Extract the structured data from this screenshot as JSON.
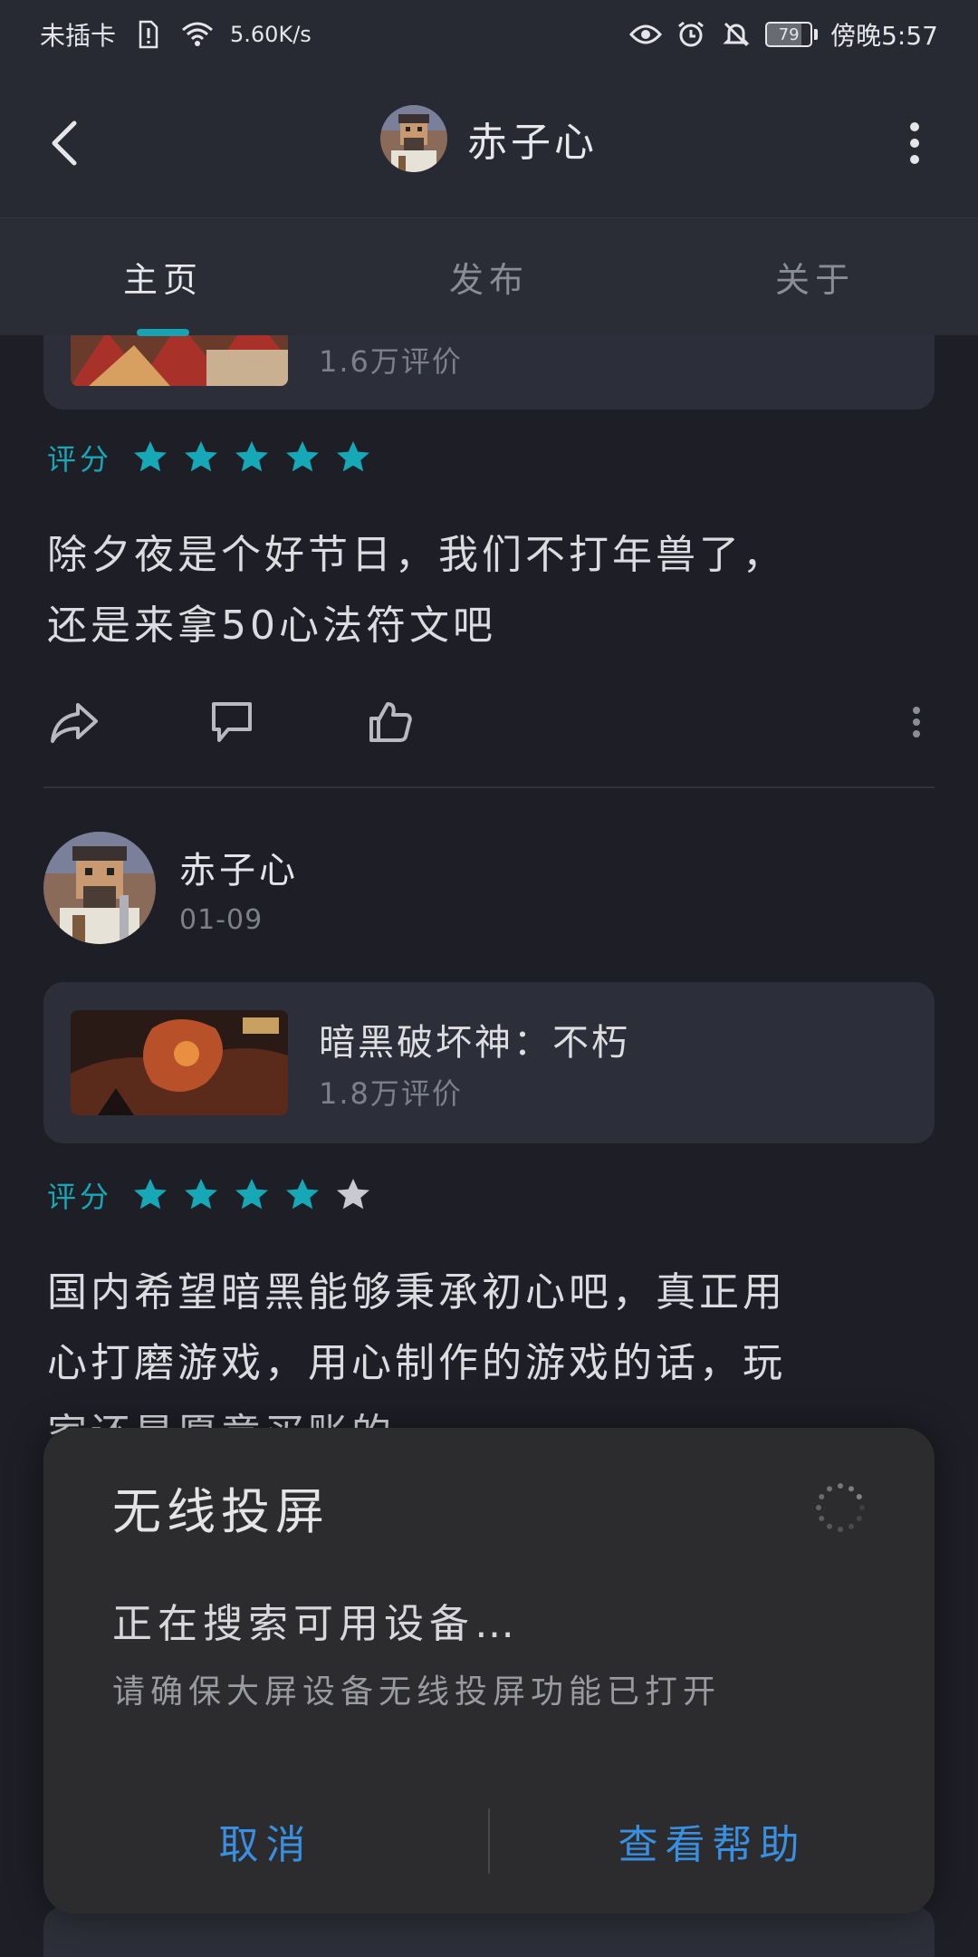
{
  "status_bar": {
    "carrier": "未插卡",
    "speed": "5.60K/s",
    "battery": "79",
    "time": "傍晚5:57"
  },
  "app_bar": {
    "title": "赤子心"
  },
  "tabs": [
    {
      "label": "主页",
      "active": true
    },
    {
      "label": "发布",
      "active": false
    },
    {
      "label": "关于",
      "active": false
    }
  ],
  "feed": {
    "partial_card": {
      "reviews": "1.6万评价"
    },
    "post1": {
      "rating_label": "评分",
      "rating": 5,
      "text_line1": "除夕夜是个好节日，我们不打年兽了，",
      "text_line2": "还是来拿50心法符文吧"
    },
    "post2": {
      "author": "赤子心",
      "date": "01-09",
      "game": {
        "name": "暗黑破坏神：不朽",
        "reviews": "1.8万评价"
      },
      "rating_label": "评分",
      "rating": 4,
      "text_line1": "国内希望暗黑能够秉承初心吧，真正用",
      "text_line2": "心打磨游戏，用心制作的游戏的话，玩",
      "text_line3": "家还是愿意买账的"
    }
  },
  "dialog": {
    "title": "无线投屏",
    "status": "正在搜索可用设备…",
    "hint": "请确保大屏设备无线投屏功能已打开",
    "cancel": "取消",
    "help": "查看帮助"
  },
  "colors": {
    "accent": "#16a3b3",
    "star_on": "#17a8b8",
    "star_off": "#c9cacf",
    "dialog_button": "#3a8fe0"
  }
}
